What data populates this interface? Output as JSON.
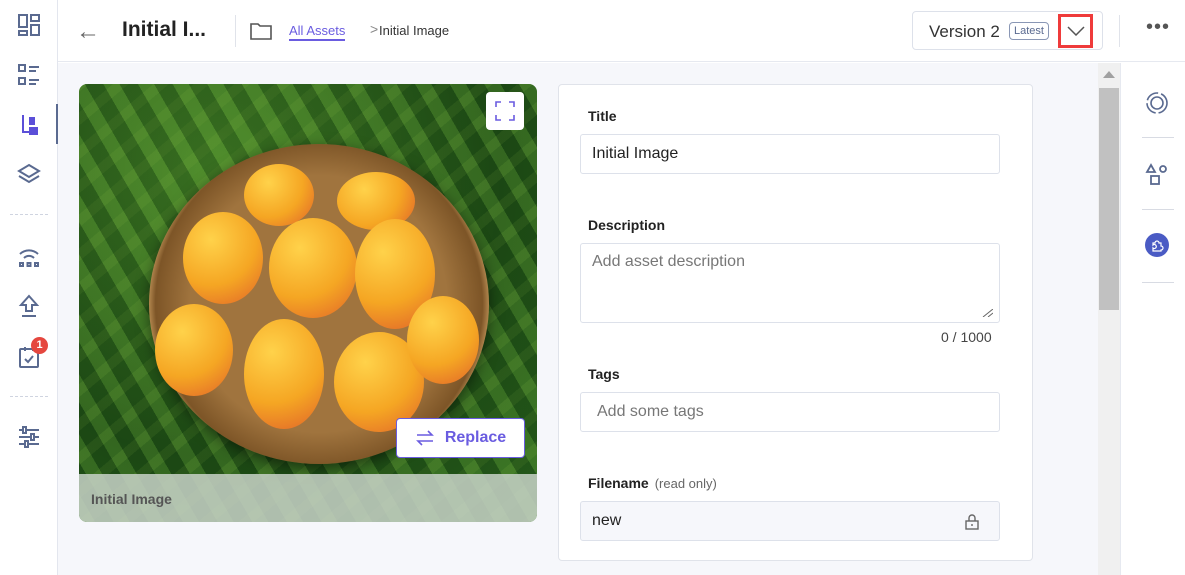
{
  "header": {
    "title": "Initial I...",
    "breadcrumb": {
      "root": "All Assets",
      "separator": ">",
      "current": "Initial Image"
    },
    "version": {
      "label": "Version 2",
      "badge": "Latest"
    },
    "more": "•••"
  },
  "sidebar": {
    "items": [
      "dashboard-icon",
      "list-icon",
      "assets-icon",
      "layers-icon",
      "network-icon",
      "upload-icon",
      "tasks-icon",
      "settings-sliders-icon"
    ],
    "active": "assets-icon",
    "tasks_badge": "1"
  },
  "image": {
    "caption": "Initial Image",
    "replace_label": "Replace"
  },
  "form": {
    "title_label": "Title",
    "title_value": "Initial Image",
    "description_label": "Description",
    "description_placeholder": "Add asset description",
    "counter": "0 / 1000",
    "tags_label": "Tags",
    "tags_placeholder": "Add some tags",
    "filename_label": "Filename",
    "filename_note": "(read only)",
    "filename_value": "new"
  },
  "right_panel": {
    "items": [
      "target-icon",
      "shapes-icon",
      "plugin-icon"
    ]
  },
  "colors": {
    "accent": "#6a5ce0",
    "highlight": "#ef3b3b",
    "icon": "#5a6a90",
    "plugin": "#4a5bc4"
  }
}
